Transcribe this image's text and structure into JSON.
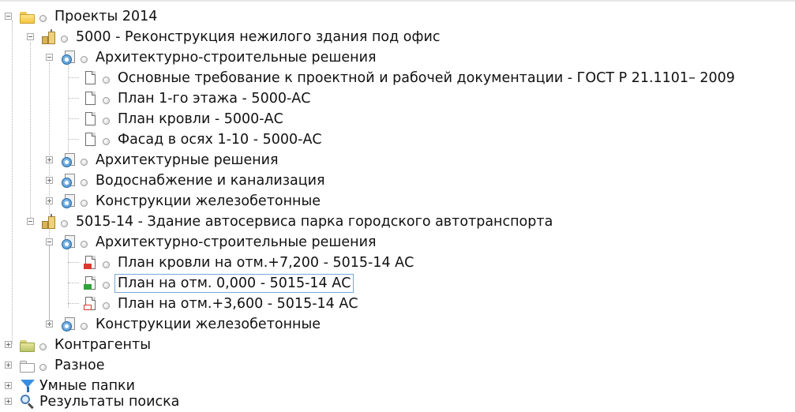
{
  "tree": {
    "projects_2014": {
      "label": "Проекты 2014",
      "icon": "folder-icon",
      "children": {
        "project_5000": {
          "label": "5000 - Реконструкция нежилого здания под офис",
          "icon": "project-icon",
          "sections": [
            {
              "label": "Архитектурно-строительные решения",
              "icon": "section-icon",
              "expanded": true,
              "documents": [
                {
                  "label": "Основные требование к проектной и рабочей документации - ГОСТ Р 21.1101– 2009",
                  "icon": "document-icon"
                },
                {
                  "label": "План 1-го этажа - 5000-АС",
                  "icon": "document-icon"
                },
                {
                  "label": "План кровли - 5000-АС",
                  "icon": "document-icon"
                },
                {
                  "label": "Фасад в осях 1-10 - 5000-АС",
                  "icon": "document-icon"
                }
              ]
            },
            {
              "label": "Архитектурные решения",
              "icon": "section-icon",
              "expanded": false
            },
            {
              "label": "Водоснабжение и канализация",
              "icon": "section-icon",
              "expanded": false
            },
            {
              "label": "Конструкции железобетонные",
              "icon": "section-icon",
              "expanded": false
            }
          ]
        },
        "project_5015": {
          "label": "5015-14 - Здание автосервиса парка городского автотранспорта",
          "icon": "project-icon",
          "sections": [
            {
              "label": "Архитектурно-строительные решения",
              "icon": "section-icon",
              "expanded": true,
              "documents": [
                {
                  "label": "План кровли на отм.+7,200 - 5015-14 АС",
                  "icon": "document-red-icon",
                  "status_color": "#d83a2e"
                },
                {
                  "label": "План на отм. 0,000 - 5015-14 АС",
                  "icon": "document-green-icon",
                  "status_color": "#2fa33b",
                  "selected": true
                },
                {
                  "label": "План на отм.+3,600 - 5015-14 АС",
                  "icon": "document-red-outline-icon",
                  "status_color": "#d83a2e"
                }
              ]
            },
            {
              "label": "Конструкции железобетонные",
              "icon": "section-icon",
              "expanded": false
            }
          ]
        }
      }
    },
    "roots": [
      {
        "label": "Контрагенты",
        "icon": "contractors-folder-icon"
      },
      {
        "label": "Разное",
        "icon": "folder-icon"
      },
      {
        "label": "Умные папки",
        "icon": "smart-folder-icon"
      },
      {
        "label": "Результаты поиска",
        "icon": "search-results-icon"
      }
    ]
  },
  "colors": {
    "selection_border": "#7aa7d6",
    "status_red": "#d83a2e",
    "status_green": "#2fa33b"
  }
}
